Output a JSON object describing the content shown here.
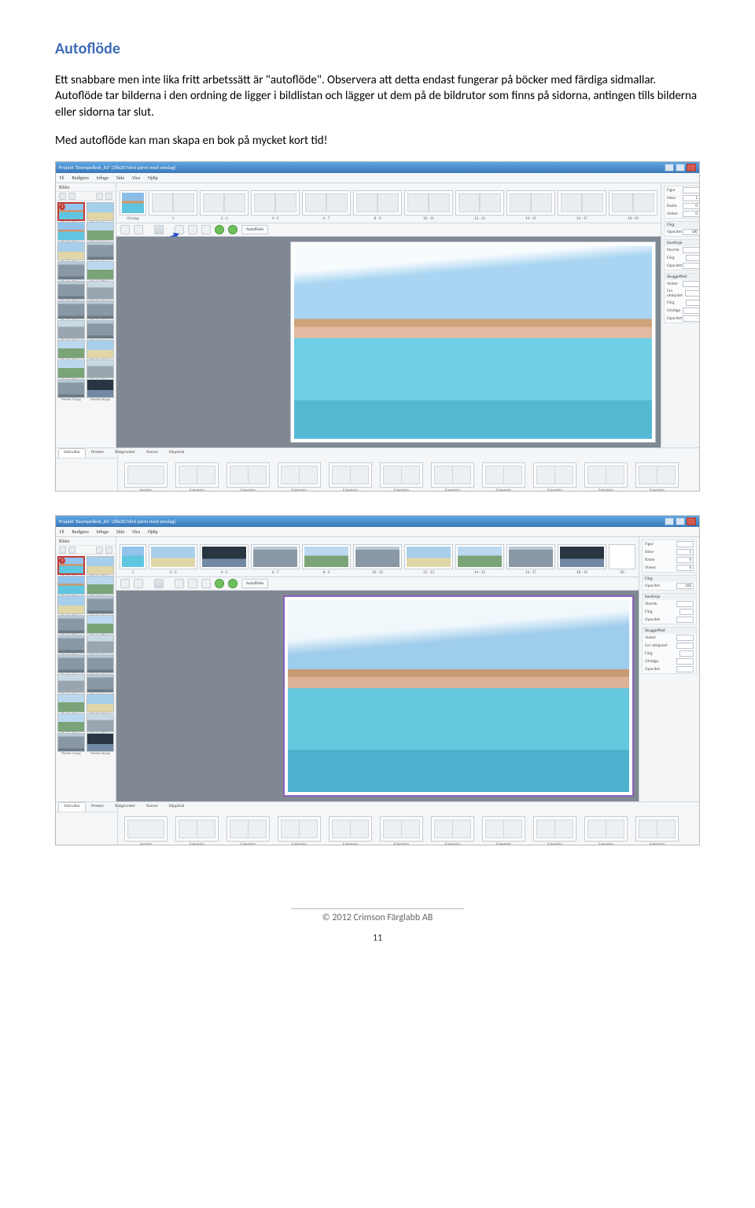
{
  "heading": "Autoflöde",
  "para1": "Ett snabbare men inte lika fritt arbetssätt är \"autoflöde\". Observera att detta endast fungerar på böcker med färdiga sidmallar. Autoflöde tar bilderna i den ordning de ligger i bildlistan och lägger ut dem på de bildrutor som finns på sidorna, antingen tills bilderna eller sidorna tar slut.",
  "para2": "Med autoflöde kan man skapa en bok på mycket kort tid!",
  "app": {
    "title": "Projekt 'Exempelbok_A3' (28x20 hård pärm med omslag)",
    "menu": [
      "Fil",
      "Redigera",
      "Infoga",
      "Sida",
      "Visa",
      "Hjälp"
    ],
    "leftHeader": "Bilder",
    "thumbs": [
      {
        "cap": "florida-01.jpg",
        "cls": "pool",
        "badge": "1"
      },
      {
        "cap": "florida-02.jpg",
        "cls": "beach"
      },
      {
        "cap": "florida-03.jpg",
        "cls": "pool"
      },
      {
        "cap": "florida-04.jpg",
        "cls": "palm"
      },
      {
        "cap": "florida-05.jpg",
        "cls": "beach"
      },
      {
        "cap": "florida-06.jpg",
        "cls": "city"
      },
      {
        "cap": "florida-07.jpg",
        "cls": "city"
      },
      {
        "cap": "florida-08.jpg",
        "cls": "palm"
      },
      {
        "cap": "florida-09.jpg",
        "cls": "city"
      },
      {
        "cap": "florida-10.jpg",
        "cls": "street"
      },
      {
        "cap": "florida-11.jpg",
        "cls": "city"
      },
      {
        "cap": "florida-12.jpg",
        "cls": "city"
      },
      {
        "cap": "florida-13.jpg",
        "cls": "street"
      },
      {
        "cap": "florida-14.jpg",
        "cls": "city"
      },
      {
        "cap": "florida-15.jpg",
        "cls": "palm"
      },
      {
        "cap": "florida-16.jpg",
        "cls": "beach"
      },
      {
        "cap": "florida-17.jpg",
        "cls": "palm"
      },
      {
        "cap": "florida-18.jpg",
        "cls": "street"
      },
      {
        "cap": "florida-19.jpg",
        "cls": "city"
      },
      {
        "cap": "florida-20.jpg",
        "cls": "night"
      }
    ],
    "pages1": [
      {
        "lbl": "Omslag",
        "type": "first"
      },
      {
        "lbl": "1",
        "type": "double"
      },
      {
        "lbl": "2 - 3",
        "type": "double"
      },
      {
        "lbl": "4 - 5",
        "type": "double"
      },
      {
        "lbl": "6 - 7",
        "type": "double"
      },
      {
        "lbl": "8 - 9",
        "type": "double"
      },
      {
        "lbl": "10 - 11",
        "type": "double"
      },
      {
        "lbl": "12 - 13",
        "type": "double"
      },
      {
        "lbl": "14 - 15",
        "type": "double"
      },
      {
        "lbl": "16 - 17",
        "type": "double"
      },
      {
        "lbl": "18 - 19",
        "type": "double"
      }
    ],
    "pages2": [
      {
        "lbl": "1",
        "type": "last",
        "img": "pool"
      },
      {
        "lbl": "2 - 3",
        "type": "double",
        "img": "beach"
      },
      {
        "lbl": "4 - 5",
        "type": "double",
        "img": "night"
      },
      {
        "lbl": "6 - 7",
        "type": "double",
        "img": "city"
      },
      {
        "lbl": "8 - 9",
        "type": "double",
        "img": "palm"
      },
      {
        "lbl": "10 - 11",
        "type": "double",
        "img": "city"
      },
      {
        "lbl": "12 - 13",
        "type": "double",
        "img": "beach"
      },
      {
        "lbl": "14 - 15",
        "type": "double",
        "img": "palm"
      },
      {
        "lbl": "16 - 17",
        "type": "double",
        "img": "city"
      },
      {
        "lbl": "18 - 19",
        "type": "double",
        "img": "night"
      },
      {
        "lbl": "20",
        "type": "last"
      }
    ],
    "autoflow": "Autoflöde",
    "bottomTabs": [
      "Sidmallar",
      "Masker",
      "Bakgrunder",
      "Ramar",
      "Klippbok"
    ],
    "templates": [
      "Helsida",
      "Enkelsida",
      "Enkelsida",
      "Enkelsida",
      "Enkelsida",
      "Enkelsida",
      "Enkelsida",
      "Enkelsida",
      "Enkelsida",
      "Enkelsida",
      "Enkelsida"
    ],
    "props": {
      "g1": [
        {
          "k": "Figur",
          "v": ""
        },
        {
          "k": "Sidor",
          "v": "1"
        },
        {
          "k": "Radie",
          "v": "0"
        },
        {
          "k": "Vinkel",
          "v": "0"
        }
      ],
      "g2h": "Färg",
      "g2": [
        {
          "k": "Opacitet",
          "v": "100"
        }
      ],
      "g3h": "Kantlinje",
      "g3": [
        {
          "k": "Storlek",
          "v": ""
        },
        {
          "k": "Färg",
          "v": ""
        },
        {
          "k": "Opacitet",
          "v": ""
        }
      ],
      "g4h": "Skuggeffekt",
      "g4": [
        {
          "k": "Vinkel",
          "v": ""
        },
        {
          "k": "Cm utskjutet",
          "v": ""
        },
        {
          "k": "Färg",
          "v": ""
        },
        {
          "k": "Utvidga",
          "v": ""
        },
        {
          "k": "Opacitet",
          "v": ""
        }
      ]
    }
  },
  "footer": {
    "copyright": "© 2012 Crimson Färglabb AB",
    "page": "11"
  }
}
